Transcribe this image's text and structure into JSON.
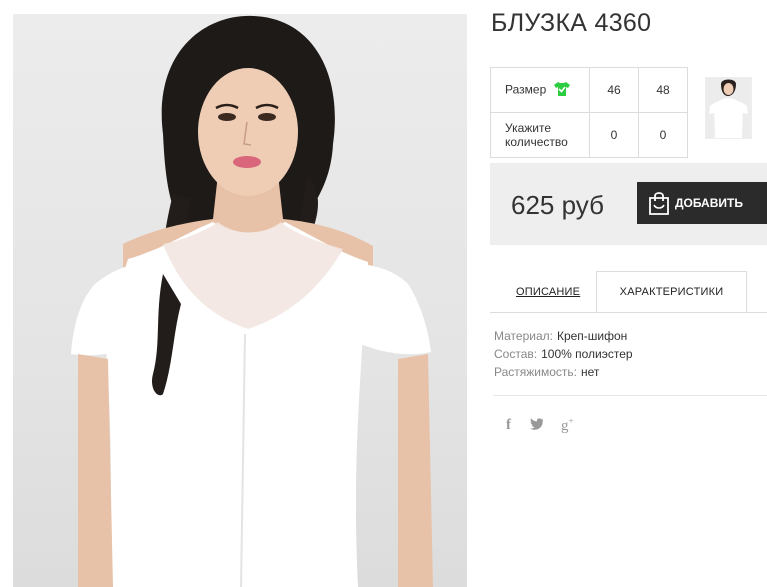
{
  "product": {
    "title": "БЛУЗКА 4360",
    "price": "625 руб",
    "add_to_cart_label": "ДОБАВИТЬ"
  },
  "size_table": {
    "size_label": "Размер",
    "sizes": [
      "46",
      "48"
    ],
    "quantity_label": "Укажите количество",
    "quantities": [
      "0",
      "0"
    ]
  },
  "tabs": {
    "description": "ОПИСАНИЕ",
    "characteristics": "ХАРАКТЕРИСТИКИ"
  },
  "specs": [
    {
      "label": "Материал:",
      "value": "Креп-шифон"
    },
    {
      "label": "Состав:",
      "value": "100% полиэстер"
    },
    {
      "label": "Растяжимость:",
      "value": "нет"
    }
  ],
  "social": {
    "facebook": "f",
    "twitter": "twitter-bird",
    "googleplus": "g+"
  },
  "colors": {
    "size_icon": "#2ecc40",
    "button_bg": "#2b2b2b",
    "price_bg": "#eeeeee"
  }
}
